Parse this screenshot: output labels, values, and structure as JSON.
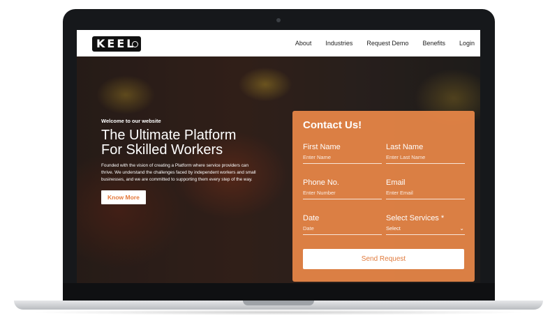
{
  "logo": {
    "text": "KEEL"
  },
  "nav": {
    "links": [
      {
        "label": "About"
      },
      {
        "label": "Industries"
      },
      {
        "label": "Request Demo"
      },
      {
        "label": "Benefits"
      },
      {
        "label": "Login"
      }
    ]
  },
  "hero": {
    "welcome": "Welcome to our website",
    "title_line1": "The Ultimate Platform",
    "title_line2": "For Skilled Workers",
    "description": "Founded with the vision of creating a Platform where service providers can thrive. We understand the challenges faced by independent workers and small businesses, and we are committed to supporting them every step of the way.",
    "cta_label": "Know More"
  },
  "contact": {
    "title": "Contact Us!",
    "fields": {
      "first_name": {
        "label": "First Name",
        "placeholder": "Enter Name"
      },
      "last_name": {
        "label": "Last Name",
        "placeholder": "Enter Last Name"
      },
      "phone": {
        "label": "Phone No.",
        "placeholder": "Enter Number"
      },
      "email": {
        "label": "Email",
        "placeholder": "Enter Email"
      },
      "date": {
        "label": "Date",
        "placeholder": "Date"
      },
      "services": {
        "label": "Select Services *",
        "value": "Select"
      }
    },
    "submit_label": "Send Request"
  },
  "colors": {
    "accent": "#e58547",
    "button_text": "#e07a3c",
    "bezel": "#16181b"
  }
}
